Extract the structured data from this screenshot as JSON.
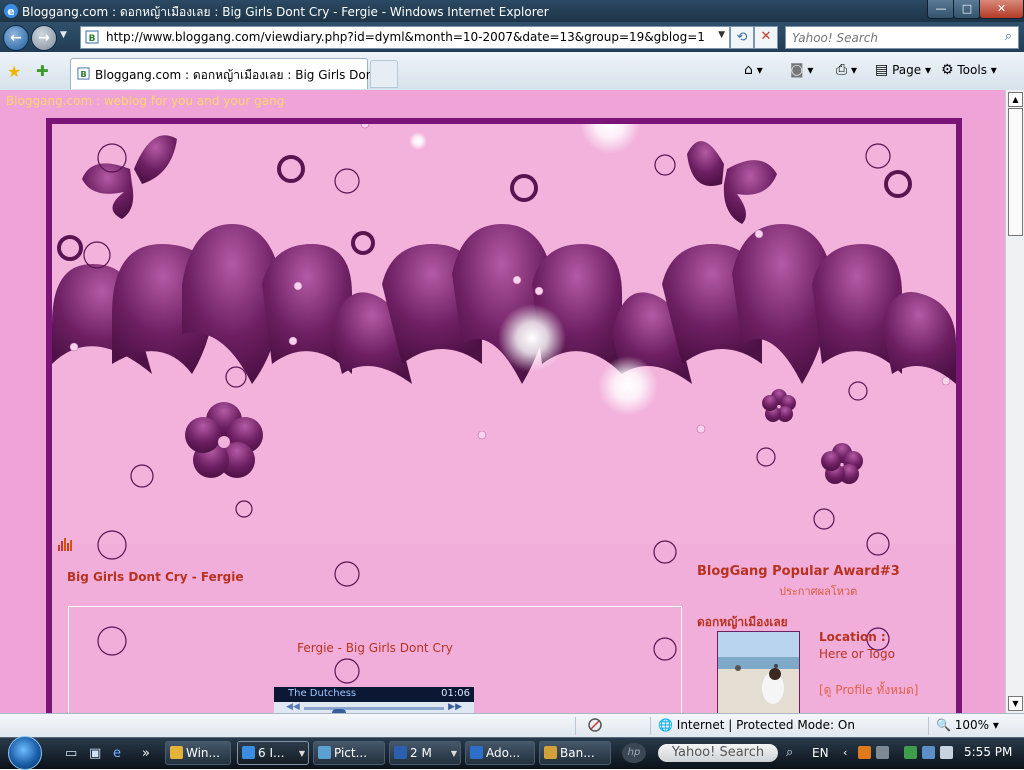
{
  "window": {
    "title": "Bloggang.com : ดอกหญ้าเมืองเลย : Big Girls Dont Cry - Fergie - Windows Internet Explorer",
    "minimize_glyph": "—",
    "maximize_glyph": "□",
    "close_glyph": "✕"
  },
  "address_bar": {
    "url": "http://www.bloggang.com/viewdiary.php?id=dyml&month=10-2007&date=13&group=19&gblog=1",
    "back_glyph": "←",
    "forward_glyph": "→",
    "refresh_glyph": "⟲",
    "stop_glyph": "✕"
  },
  "search_bar": {
    "placeholder": "Yahoo! Search",
    "icon": "search-icon"
  },
  "tab": {
    "label": "Bloggang.com : ดอกหญ้าเมืองเลย : Big Girls Dont ..."
  },
  "command_bar": {
    "page_label": "Page",
    "tools_label": "Tools",
    "icons": [
      "home-icon",
      "rss-icon",
      "print-icon",
      "page-icon",
      "tools-gear-icon"
    ]
  },
  "page": {
    "site_link": "Bloggang.com : weblog for you and your gang",
    "post_title": "Big Girls Dont Cry - Fergie",
    "song_title": "Fergie - Big Girls Dont Cry",
    "player": {
      "track": "The Dutchess",
      "time": "01:06",
      "progress": 0.2
    },
    "sidebar": {
      "award_title": "BlogGang Popular Award#3",
      "award_sub": "ประกาศผลโหวต",
      "blog_name": "ดอกหญ้าเมืองเลย",
      "location_label": "Location :",
      "location_value": "Here or Togo",
      "profile_link": "[ดู Profile ทั้งหมด]"
    },
    "colors": {
      "background": "#efa3d6",
      "frame": "#7b1477",
      "petal": "#7a2a6d",
      "text_accent": "#b8321f",
      "site_link": "#ffd66a"
    }
  },
  "status_bar": {
    "zone": "Internet | Protected Mode: On",
    "zoom": "100%"
  },
  "taskbar": {
    "buttons": [
      {
        "label": "Win...",
        "icon": "explorer-icon",
        "color": "#e3b33a"
      },
      {
        "label": "6 I...",
        "icon": "ie-icon",
        "color": "#3a8de0"
      },
      {
        "label": "Pict...",
        "icon": "picture-icon",
        "color": "#5aa0d0"
      },
      {
        "label": "2 M",
        "icon": "word-icon",
        "color": "#2b5fb0"
      },
      {
        "label": "Ado...",
        "icon": "adobe-icon",
        "color": "#2c6fc9"
      },
      {
        "label": "Ban...",
        "icon": "banner-icon",
        "color": "#d2a23a"
      }
    ],
    "search_label": "Yahoo! Search",
    "language": "EN",
    "clock": "5:55 PM"
  }
}
